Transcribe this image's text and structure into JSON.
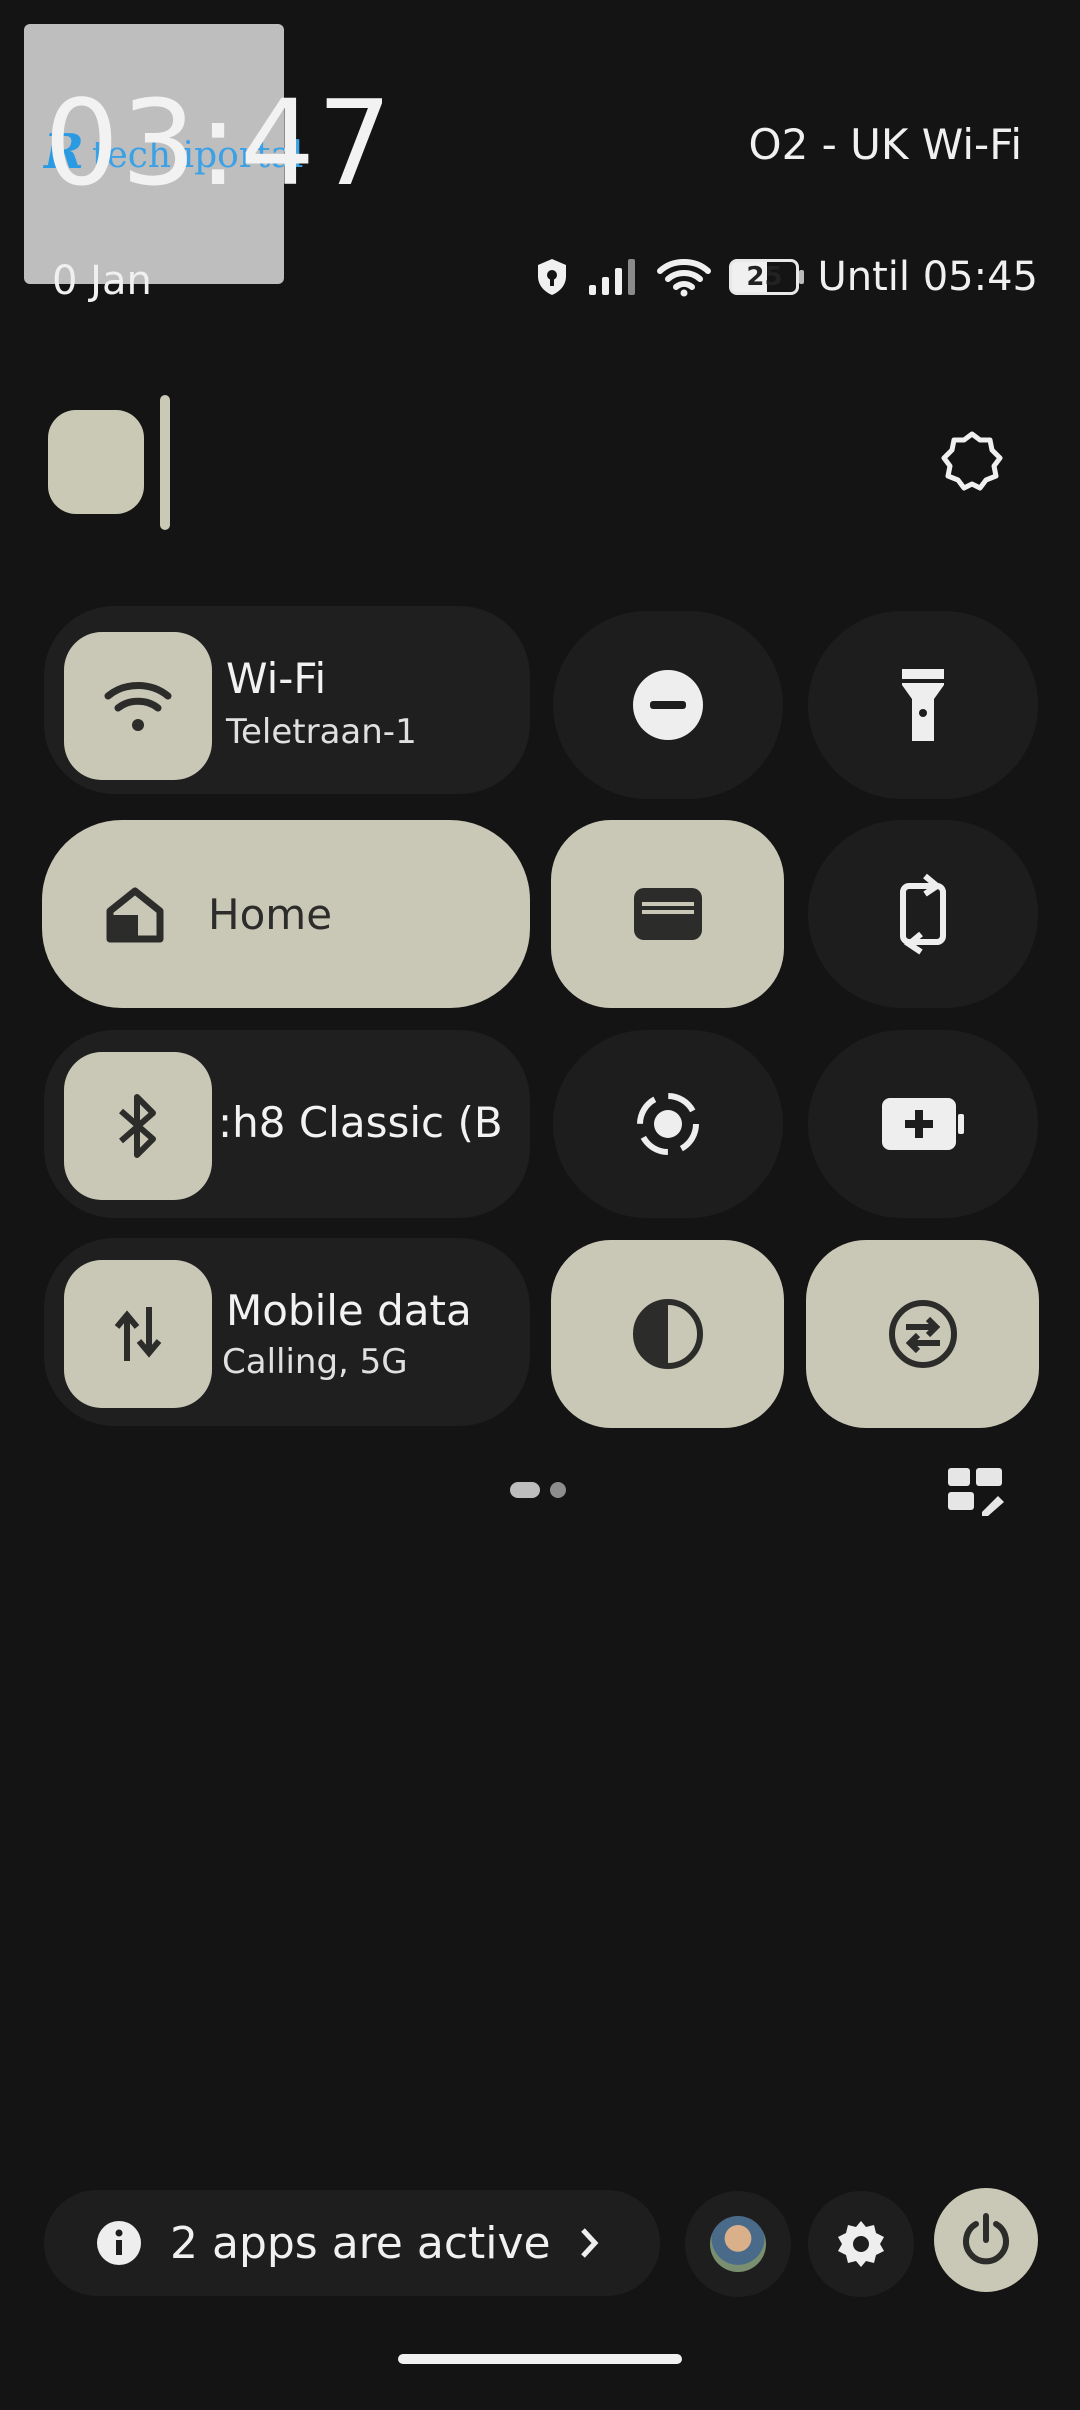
{
  "status_bar": {
    "time": "03:47",
    "date": "0 Jan",
    "carrier": "O2 - UK Wi-Fi",
    "battery_level": "25",
    "battery_text": "Until 05:45"
  },
  "watermark": {
    "text": "tech.iportal"
  },
  "tiles": {
    "wifi": {
      "label": "Wi-Fi",
      "sub": "Teletraan-1"
    },
    "home": {
      "label": "Home"
    },
    "bluetooth": {
      "label": ":h8 Classic (B"
    },
    "mobile_data": {
      "label": "Mobile data",
      "sub": "Calling, 5G"
    }
  },
  "footer": {
    "active_apps": "2 apps are active"
  },
  "colors": {
    "background": "#141414",
    "tile_active": "#c9c8b6",
    "tile_inactive": "#1f1f1f"
  }
}
